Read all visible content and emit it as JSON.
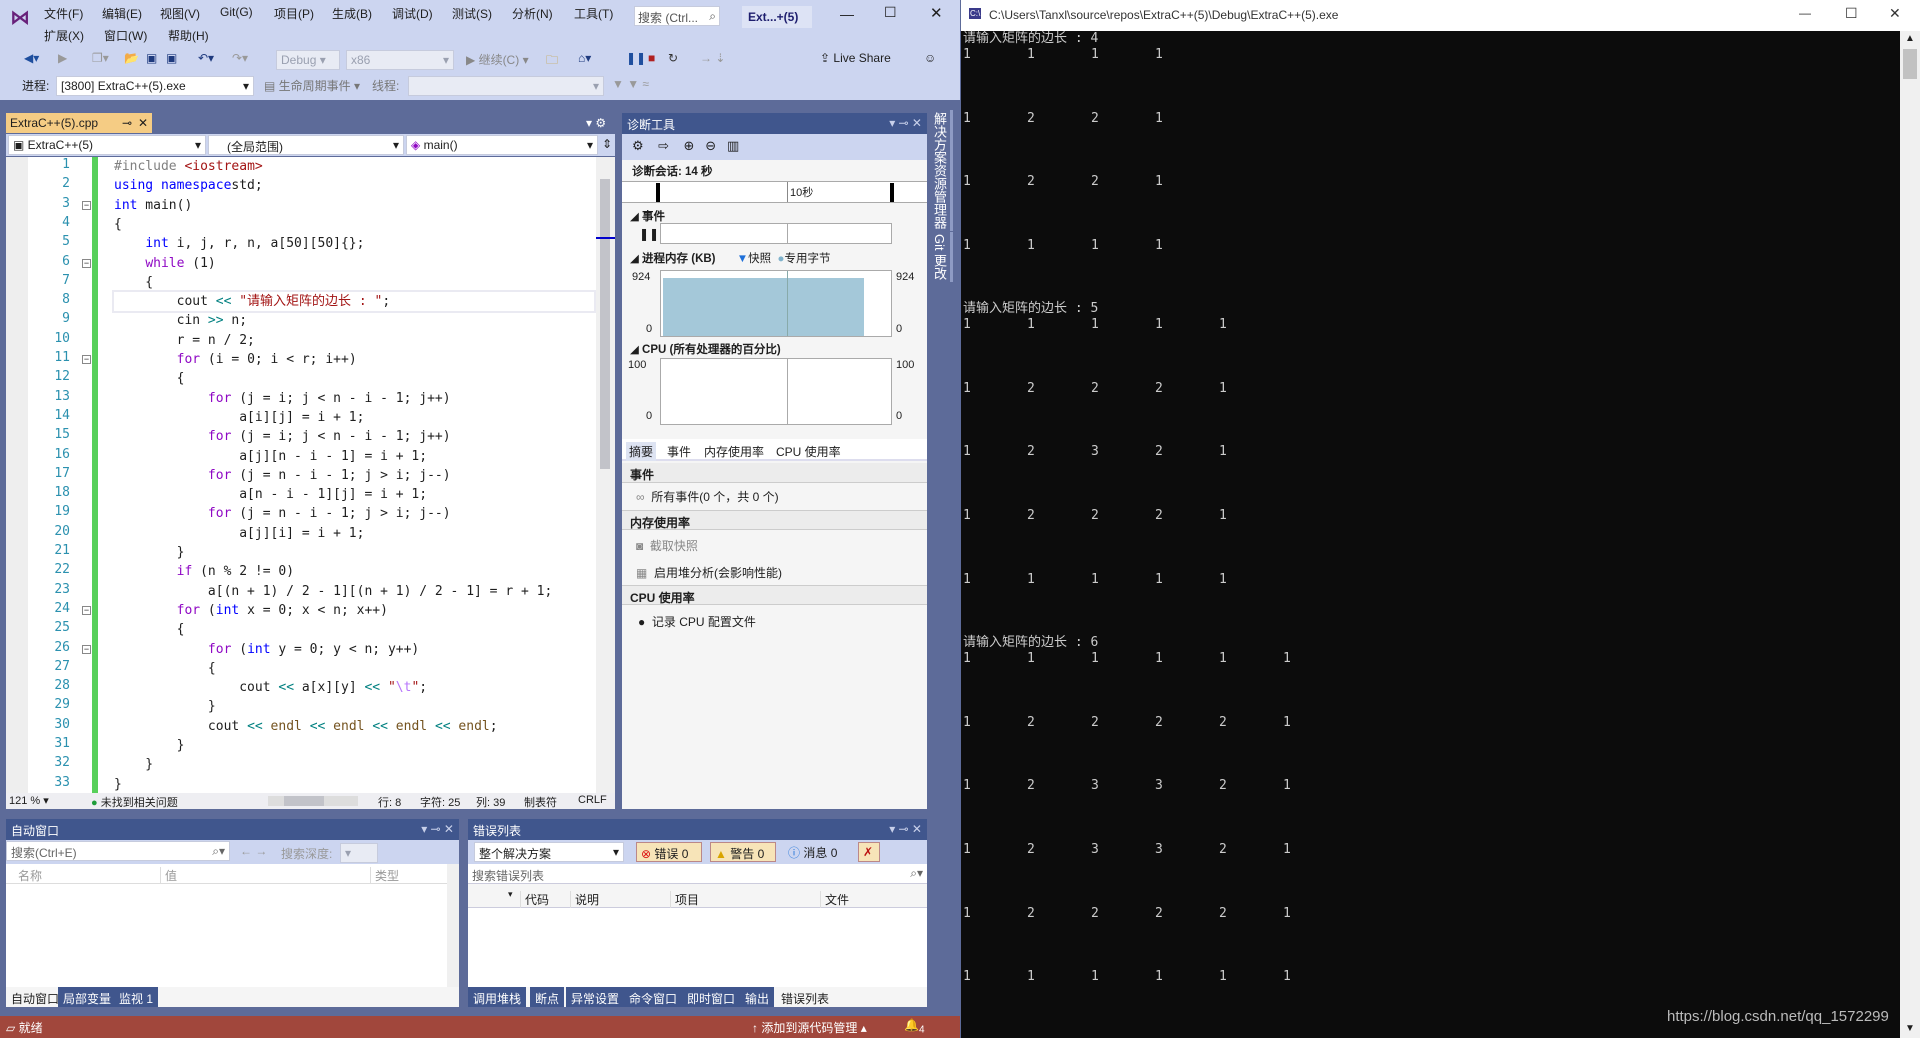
{
  "vs": {
    "menu_row1": [
      "文件(F)",
      "编辑(E)",
      "视图(V)",
      "Git(G)",
      "项目(P)",
      "生成(B)",
      "调试(D)",
      "测试(S)",
      "分析(N)",
      "工具(T)"
    ],
    "menu_row2": [
      "扩展(X)",
      "窗口(W)",
      "帮助(H)"
    ],
    "search_placeholder": "搜索 (Ctrl...",
    "solution_name": "Ext...+(5)",
    "toolbar": {
      "config": "Debug",
      "platform": "x86",
      "continue": "继续(C)",
      "live_share": "Live Share",
      "process_label": "进程:",
      "process": "[3800] ExtraC++(5).exe",
      "lifecycle": "生命周期事件",
      "thread_label": "线程:"
    },
    "editor": {
      "tab": "ExtraC++(5).cpp",
      "nav": {
        "project": "ExtraC++(5)",
        "scope": "(全局范围)",
        "member": "main()"
      },
      "code": [
        [
          [
            "pp",
            "#include "
          ],
          [
            "str",
            "<iostream>"
          ]
        ],
        [
          [
            "kw",
            "using namespace"
          ],
          [
            "",
            "std;"
          ]
        ],
        [
          [
            "kw",
            "int"
          ],
          [
            "",
            " main()"
          ]
        ],
        [
          [
            "",
            "{"
          ]
        ],
        [
          [
            "",
            "    "
          ],
          [
            "kw",
            "int"
          ],
          [
            "",
            " i, j, r, n, a[50][50]{};"
          ]
        ],
        [
          [
            "",
            "    "
          ],
          [
            "ctl",
            "while"
          ],
          [
            "",
            " (1)"
          ]
        ],
        [
          [
            "",
            "    {"
          ]
        ],
        [
          [
            "",
            "        cout "
          ],
          [
            "op",
            "<<"
          ],
          [
            "",
            " "
          ],
          [
            "str",
            "\"请输入矩阵的边长 : \""
          ],
          [
            "",
            ";"
          ]
        ],
        [
          [
            "",
            "        cin "
          ],
          [
            "op",
            ">>"
          ],
          [
            "",
            " n;"
          ]
        ],
        [
          [
            "",
            "        r = n / 2;"
          ]
        ],
        [
          [
            "",
            "        "
          ],
          [
            "ctl",
            "for"
          ],
          [
            "",
            " (i = 0; i < r; i++)"
          ]
        ],
        [
          [
            "",
            "        {"
          ]
        ],
        [
          [
            "",
            "            "
          ],
          [
            "ctl",
            "for"
          ],
          [
            "",
            " (j = i; j < n - i - 1; j++)"
          ]
        ],
        [
          [
            "",
            "                a[i][j] = i + 1;"
          ]
        ],
        [
          [
            "",
            "            "
          ],
          [
            "ctl",
            "for"
          ],
          [
            "",
            " (j = i; j < n - i - 1; j++)"
          ]
        ],
        [
          [
            "",
            "                a[j][n - i - 1] = i + 1;"
          ]
        ],
        [
          [
            "",
            "            "
          ],
          [
            "ctl",
            "for"
          ],
          [
            "",
            " (j = n - i - 1; j > i; j--)"
          ]
        ],
        [
          [
            "",
            "                a[n - i - 1][j] = i + 1;"
          ]
        ],
        [
          [
            "",
            "            "
          ],
          [
            "ctl",
            "for"
          ],
          [
            "",
            " (j = n - i - 1; j > i; j--)"
          ]
        ],
        [
          [
            "",
            "                a[j][i] = i + 1;"
          ]
        ],
        [
          [
            "",
            "        }"
          ]
        ],
        [
          [
            "",
            "        "
          ],
          [
            "ctl",
            "if"
          ],
          [
            "",
            " (n % 2 != 0)"
          ]
        ],
        [
          [
            "",
            "            a[(n + 1) / 2 - 1][(n + 1) / 2 - 1] = r + 1;"
          ]
        ],
        [
          [
            "",
            "        "
          ],
          [
            "ctl",
            "for"
          ],
          [
            "",
            " ("
          ],
          [
            "kw",
            "int"
          ],
          [
            "",
            " x = 0; x < n; x++)"
          ]
        ],
        [
          [
            "",
            "        {"
          ]
        ],
        [
          [
            "",
            "            "
          ],
          [
            "ctl",
            "for"
          ],
          [
            "",
            " ("
          ],
          [
            "kw",
            "int"
          ],
          [
            "",
            " y = 0; y < n; y++)"
          ]
        ],
        [
          [
            "",
            "            {"
          ]
        ],
        [
          [
            "",
            "                cout "
          ],
          [
            "op",
            "<<"
          ],
          [
            "",
            " a[x][y] "
          ],
          [
            "op",
            "<<"
          ],
          [
            "",
            " "
          ],
          [
            "str",
            "\""
          ],
          [
            "esc",
            "\\t"
          ],
          [
            "str",
            "\""
          ],
          [
            "",
            ";"
          ]
        ],
        [
          [
            "",
            "            }"
          ]
        ],
        [
          [
            "",
            "            cout "
          ],
          [
            "op",
            "<<"
          ],
          [
            "",
            " "
          ],
          [
            "fn",
            "endl"
          ],
          [
            "",
            " "
          ],
          [
            "op",
            "<<"
          ],
          [
            "",
            " "
          ],
          [
            "fn",
            "endl"
          ],
          [
            "",
            " "
          ],
          [
            "op",
            "<<"
          ],
          [
            "",
            " "
          ],
          [
            "fn",
            "endl"
          ],
          [
            "",
            " "
          ],
          [
            "op",
            "<<"
          ],
          [
            "",
            " "
          ],
          [
            "fn",
            "endl"
          ],
          [
            "",
            ";"
          ]
        ],
        [
          [
            "",
            "        }"
          ]
        ],
        [
          [
            "",
            "    }"
          ]
        ],
        [
          [
            "",
            "}"
          ]
        ]
      ],
      "fold_lines": [
        3,
        6,
        11,
        24,
        26
      ],
      "current_line": 8,
      "status": {
        "zoom": "121 %",
        "issues": "未找到相关问题",
        "line": "行: 8",
        "char": "字符: 25",
        "col": "列: 39",
        "tabs": "制表符",
        "eol": "CRLF"
      }
    },
    "diag": {
      "title": "诊断工具",
      "session": "诊断会话: 14 秒",
      "time_label": "10秒",
      "events": "事件",
      "memory": "进程内存 (KB)",
      "snapshot": "快照",
      "private_bytes": "专用字节",
      "mem_max": "924",
      "mem_min": "0",
      "memory_fill_fraction": 0.88,
      "cpu": "CPU (所有处理器的百分比)",
      "cpu_max": "100",
      "cpu_min": "0",
      "tabs": [
        "摘要",
        "事件",
        "内存使用率",
        "CPU 使用率"
      ],
      "sec_events": "事件",
      "all_events": "所有事件(0 个，共 0 个)",
      "sec_memory": "内存使用率",
      "take_snapshot": "截取快照",
      "heap": "启用堆分析(会影响性能)",
      "sec_cpu": "CPU 使用率",
      "record_cpu": "记录 CPU 配置文件"
    },
    "side_tabs": [
      "解决方案资源管理器",
      "Git 更改"
    ],
    "autos": {
      "title": "自动窗口",
      "search": "搜索(Ctrl+E)",
      "depth": "搜索深度:",
      "cols": [
        "名称",
        "值",
        "类型"
      ],
      "tabs": [
        "自动窗口",
        "局部变量",
        "监视 1"
      ]
    },
    "errors": {
      "title": "错误列表",
      "scope": "整个解决方案",
      "errors": "错误 0",
      "warnings": "警告 0",
      "messages": "消息 0",
      "search": "搜索错误列表",
      "cols": [
        "代码",
        "说明",
        "项目",
        "文件"
      ],
      "tabs": [
        "调用堆栈",
        "断点",
        "异常设置",
        "命令窗口",
        "即时窗口",
        "输出",
        "错误列表"
      ]
    },
    "statusbar": {
      "ready": "就绪",
      "source_control": "添加到源代码管理",
      "notifications": "4",
      "color": "#a1473c"
    }
  },
  "console": {
    "title": "C:\\Users\\Tanxl\\source\\repos\\ExtraC++(5)\\Debug\\ExtraC++(5).exe",
    "prompt": "请输入矩阵的边长 : ",
    "runs": [
      {
        "input": "4",
        "rows": [
          [
            1,
            1,
            1,
            1
          ],
          [
            1,
            2,
            2,
            1
          ],
          [
            1,
            2,
            2,
            1
          ],
          [
            1,
            1,
            1,
            1
          ]
        ]
      },
      {
        "input": "5",
        "rows": [
          [
            1,
            1,
            1,
            1,
            1
          ],
          [
            1,
            2,
            2,
            2,
            1
          ],
          [
            1,
            2,
            3,
            2,
            1
          ],
          [
            1,
            2,
            2,
            2,
            1
          ],
          [
            1,
            1,
            1,
            1,
            1
          ]
        ]
      },
      {
        "input": "6",
        "rows": [
          [
            1,
            1,
            1,
            1,
            1,
            1
          ],
          [
            1,
            2,
            2,
            2,
            2,
            1
          ],
          [
            1,
            2,
            3,
            3,
            2,
            1
          ],
          [
            1,
            2,
            3,
            3,
            2,
            1
          ],
          [
            1,
            2,
            2,
            2,
            2,
            1
          ],
          [
            1,
            1,
            1,
            1,
            1,
            1
          ]
        ]
      }
    ],
    "watermark": "https://blog.csdn.net/qq_1572299"
  }
}
